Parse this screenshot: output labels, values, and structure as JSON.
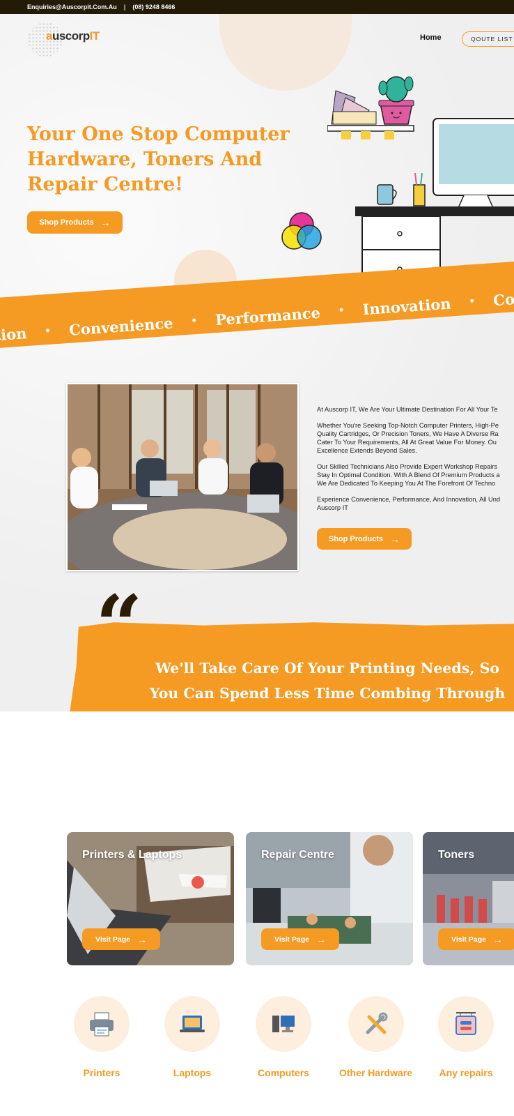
{
  "topbar": {
    "email": "Enquiries@Auscorpit.Com.Au",
    "separator": "|",
    "phone": "(08) 9248 8466"
  },
  "logo": {
    "prefix": "a",
    "name": "uscorp",
    "suffix": "IT"
  },
  "nav": {
    "home": "Home",
    "quote": "QOUTE LIST"
  },
  "hero": {
    "title": "Your One Stop Computer Hardware, Toners And Repair Centre!",
    "button": "Shop Products"
  },
  "ribbon": {
    "words": [
      "vation",
      "Convenience",
      "Performance",
      "Innovation",
      "Conve"
    ]
  },
  "about": {
    "paragraphs": [
      "At Auscorp IT, We Are Your Ultimate Destination For All Your Te",
      "Whether You're Seeking Top-Notch Computer Printers, High-Pe\nQuality Cartridges, Or Precision Toners, We Have A Diverse Ra\nCater To Your Requirements, All At Great Value For Money. Ou\nExcellence Extends Beyond Sales.",
      "Our Skilled Technicians Also Provide Expert Workshop Repairs\nStay In Optimal Condition. With A Blend Of Premium Products a\nWe Are Dedicated To Keeping You At The Forefront Of Techno",
      "Experience Convenience, Performance, And Innovation, All Und\nAuscorp IT"
    ],
    "button": "Shop Products"
  },
  "quote": {
    "marks": "“",
    "text": "We'll Take Care Of Your Printing Needs, So You Can Spend Less Time Combing Through Technical Specs, And More Time Doing The Stuff That's Important"
  },
  "cards": [
    {
      "title": "Printers & Laptops",
      "button": "Visit Page"
    },
    {
      "title": "Repair Centre",
      "button": "Visit Page"
    },
    {
      "title": "Toners",
      "button": "Visit Page"
    }
  ],
  "categories": [
    {
      "label": "Printers",
      "icon": "printer-icon"
    },
    {
      "label": "Laptops",
      "icon": "laptop-icon"
    },
    {
      "label": "Computers",
      "icon": "computer-icon"
    },
    {
      "label": "Other Hardware",
      "icon": "tools-icon"
    },
    {
      "label": "Any repairs",
      "icon": "repair-sign-icon"
    }
  ],
  "colors": {
    "accent": "#f59a23",
    "dark": "#231a08",
    "quote_marks": "#2b1d05"
  }
}
